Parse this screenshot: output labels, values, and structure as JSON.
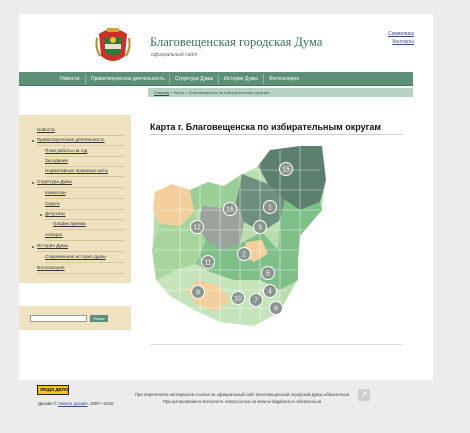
{
  "header": {
    "title": "Благовещенская городская Дума",
    "subtitle": "официальный сайт",
    "links": [
      "Символика",
      "Контакты"
    ]
  },
  "nav": {
    "items": [
      "Новости",
      "Правотворческая деятельность",
      "Структура Думы",
      "История Думы",
      "Фотогалерея"
    ]
  },
  "breadcrumb": {
    "home": "Главная",
    "trail": "» Карта г. Благовещенска по избирательным округам"
  },
  "sidebar": {
    "items": [
      {
        "label": "Новости",
        "level": 0,
        "bullet": false
      },
      {
        "label": "Правотворческая деятельность",
        "level": 0,
        "bullet": true
      },
      {
        "label": "План работы на год",
        "level": 1,
        "bullet": false
      },
      {
        "label": "Заседания",
        "level": 1,
        "bullet": false
      },
      {
        "label": "Нормативные правовые акты",
        "level": 1,
        "bullet": false
      },
      {
        "label": "Структура Думы",
        "level": 0,
        "bullet": true
      },
      {
        "label": "Комиссии",
        "level": 1,
        "bullet": false
      },
      {
        "label": "Округа",
        "level": 1,
        "bullet": false
      },
      {
        "label": "Депутаты",
        "level": 1,
        "bullet": true
      },
      {
        "label": "График приема",
        "level": 2,
        "bullet": false
      },
      {
        "label": "Аппарат",
        "level": 1,
        "bullet": false
      },
      {
        "label": "История Думы",
        "level": 0,
        "bullet": true
      },
      {
        "label": "Современная история Думы",
        "level": 1,
        "bullet": false
      },
      {
        "label": "Фотогалерея",
        "level": 0,
        "bullet": false
      }
    ]
  },
  "search": {
    "value": "",
    "button": "Поиск"
  },
  "main": {
    "title": "Карта г. Благовещенска по избирательным округам",
    "districts": [
      "1",
      "2",
      "3",
      "4",
      "5",
      "6",
      "7",
      "8",
      "9",
      "10",
      "11",
      "12",
      "13",
      "14",
      "15"
    ]
  },
  "footer": {
    "logo_text": "ЛЮДИ ДЕЛО",
    "credit_prefix": "Дизайн ©",
    "credit_link": "Лайкли дизайн",
    "credit_years": ", 2007—2010",
    "note_line1": "При перепечатке материалов ссылка на официальный сайт Благовещенской городской Думы обязательна",
    "note_line2": "При цитировании в Интернете гиперссылка на www.w-dagduma.ru обязательна"
  },
  "colors": {
    "nav": "#5e8f77",
    "sidebar": "#efe2c1",
    "map_dark": "#5d7f6e",
    "map_light": "#7fbf8a",
    "map_pale": "#b9ddb0",
    "map_sand": "#f2cf9c",
    "map_grey": "#9aa39c"
  }
}
